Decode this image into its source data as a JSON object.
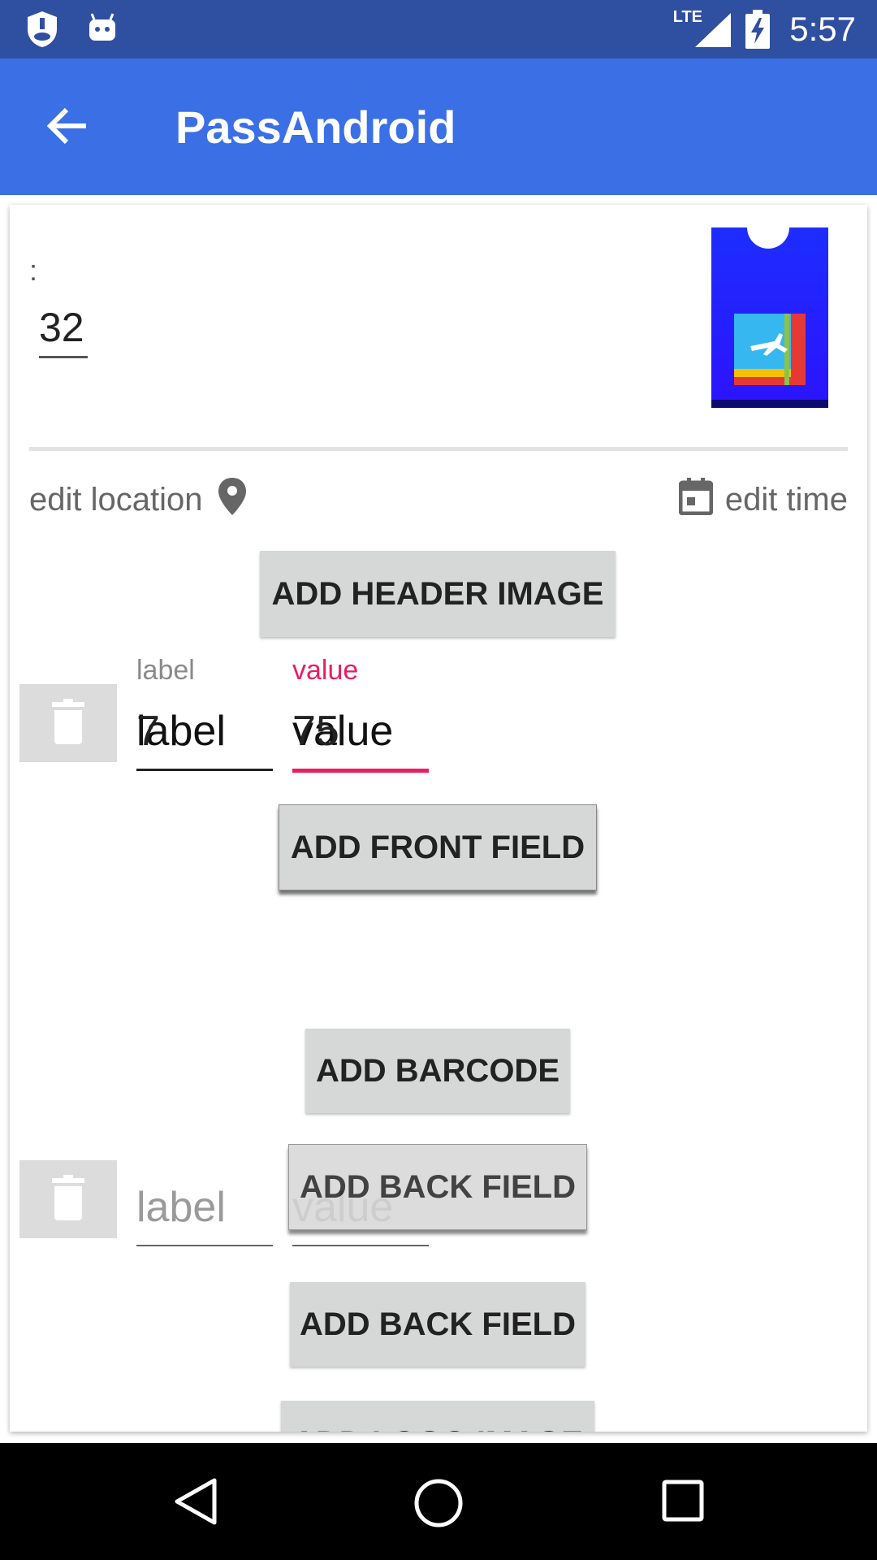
{
  "status_bar": {
    "time": "5:57",
    "network": "LTE",
    "icons": [
      "shield-icon",
      "android-icon",
      "signal-icon",
      "battery-charging-icon"
    ]
  },
  "app_bar": {
    "title": "PassAndroid",
    "back_icon": "arrow-back-icon"
  },
  "card": {
    "colon": ":",
    "number_value": "32",
    "edit_location": "edit location",
    "edit_time": "edit time",
    "add_header_image": "ADD HEADER IMAGE",
    "front_field": {
      "label_caption": "label",
      "value_caption": "value",
      "label_text": "label",
      "value_text": "value",
      "label_overlay": "7",
      "value_overlay": "75"
    },
    "add_front_field": "ADD FRONT FIELD",
    "add_barcode": "ADD BARCODE",
    "add_back_field_overlap": "ADD BACK FIELD",
    "back_field": {
      "label_placeholder": "label",
      "value_placeholder": "value"
    },
    "add_back_field": "ADD BACK FIELD",
    "add_logo_image": "ADD LOGO IMAGE"
  },
  "colors": {
    "status_bar": "#2f4fa0",
    "app_bar": "#3a6fe6",
    "accent": "#e91e63",
    "button": "#d6d7d7"
  }
}
